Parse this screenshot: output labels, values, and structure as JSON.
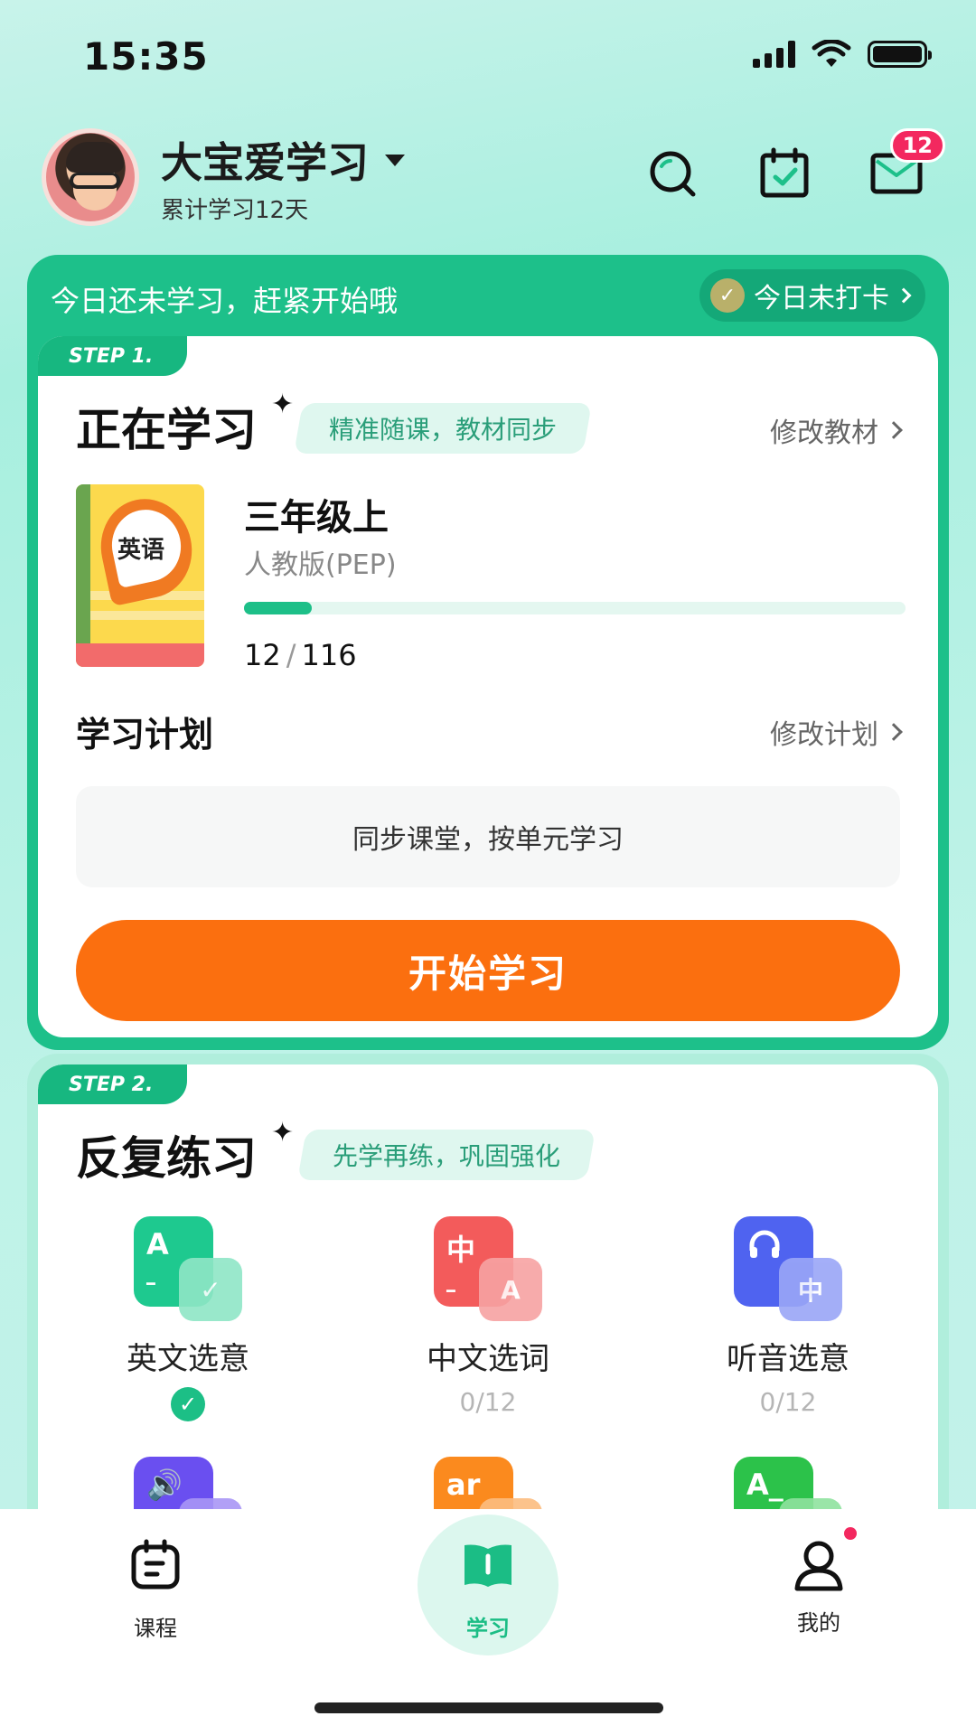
{
  "status": {
    "time": "15:35"
  },
  "header": {
    "username": "大宝爱学习",
    "study_days": "累计学习12天",
    "message_badge": "12"
  },
  "banner": {
    "text": "今日还未学习，赶紧开始哦",
    "checkin_label": "今日未打卡"
  },
  "step1": {
    "step_label": "STEP 1.",
    "title": "正在学习",
    "tag": "精准随课，教材同步",
    "change_link": "修改教材",
    "book_cover_text": "英语",
    "grade": "三年级上",
    "edition": "人教版(PEP)",
    "progress_current": "12",
    "progress_sep": "/",
    "progress_total": "116",
    "progress_fraction": 0.103,
    "plan_title": "学习计划",
    "plan_link": "修改计划",
    "plan_text": "同步课堂，按单元学习",
    "start_button": "开始学习"
  },
  "step2": {
    "step_label": "STEP 2.",
    "title": "反复练习",
    "tag": "先学再练，巩固强化",
    "exercises": [
      {
        "label": "英文选意",
        "status": "done",
        "icon_color": "#1ec98f",
        "glyph": "A"
      },
      {
        "label": "中文选词",
        "sub": "0/12",
        "icon_color": "#f35b5b",
        "glyph": "中",
        "front_glyph": "A"
      },
      {
        "label": "听音选意",
        "sub": "0/12",
        "icon_color": "#4f63f0",
        "glyph": "headphone",
        "front_glyph": "中"
      },
      {
        "icon_color": "#6a4ff0",
        "glyph": "speaker"
      },
      {
        "icon_color": "#fb8a1e",
        "glyph": "ar"
      },
      {
        "icon_color": "#2cc24a",
        "glyph": "A_"
      }
    ]
  },
  "tabbar": {
    "tabs": [
      {
        "label": "课程"
      },
      {
        "label": "学习"
      },
      {
        "label": "我的"
      }
    ]
  },
  "colors": {
    "accent": "#1dc08a",
    "orange": "#fb6f0f",
    "badge": "#f3285f"
  }
}
